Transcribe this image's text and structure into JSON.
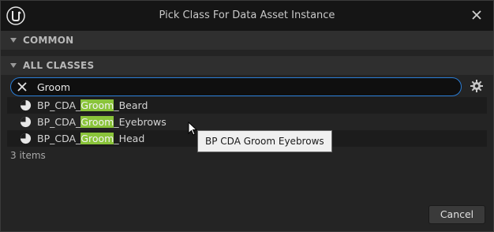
{
  "window": {
    "title": "Pick Class For Data Asset Instance"
  },
  "sections": {
    "common": "COMMON",
    "all_classes": "ALL CLASSES"
  },
  "search": {
    "value": "Groom"
  },
  "results": [
    {
      "prefix": "BP_CDA_",
      "match": "Groom",
      "suffix": "_Beard"
    },
    {
      "prefix": "BP_CDA_",
      "match": "Groom",
      "suffix": "_Eyebrows"
    },
    {
      "prefix": "BP_CDA_",
      "match": "Groom",
      "suffix": "_Head"
    }
  ],
  "item_count": "3 items",
  "tooltip": "BP CDA Groom Eyebrows",
  "buttons": {
    "cancel": "Cancel"
  },
  "colors": {
    "accent_border": "#2a7dd6",
    "match_highlight": "#8ac43a"
  },
  "icons": {
    "logo": "unreal-engine-logo-icon",
    "close": "close-icon",
    "clear": "clear-search-icon",
    "settings": "settings-gear-icon",
    "row": "data-asset-pie-icon"
  }
}
